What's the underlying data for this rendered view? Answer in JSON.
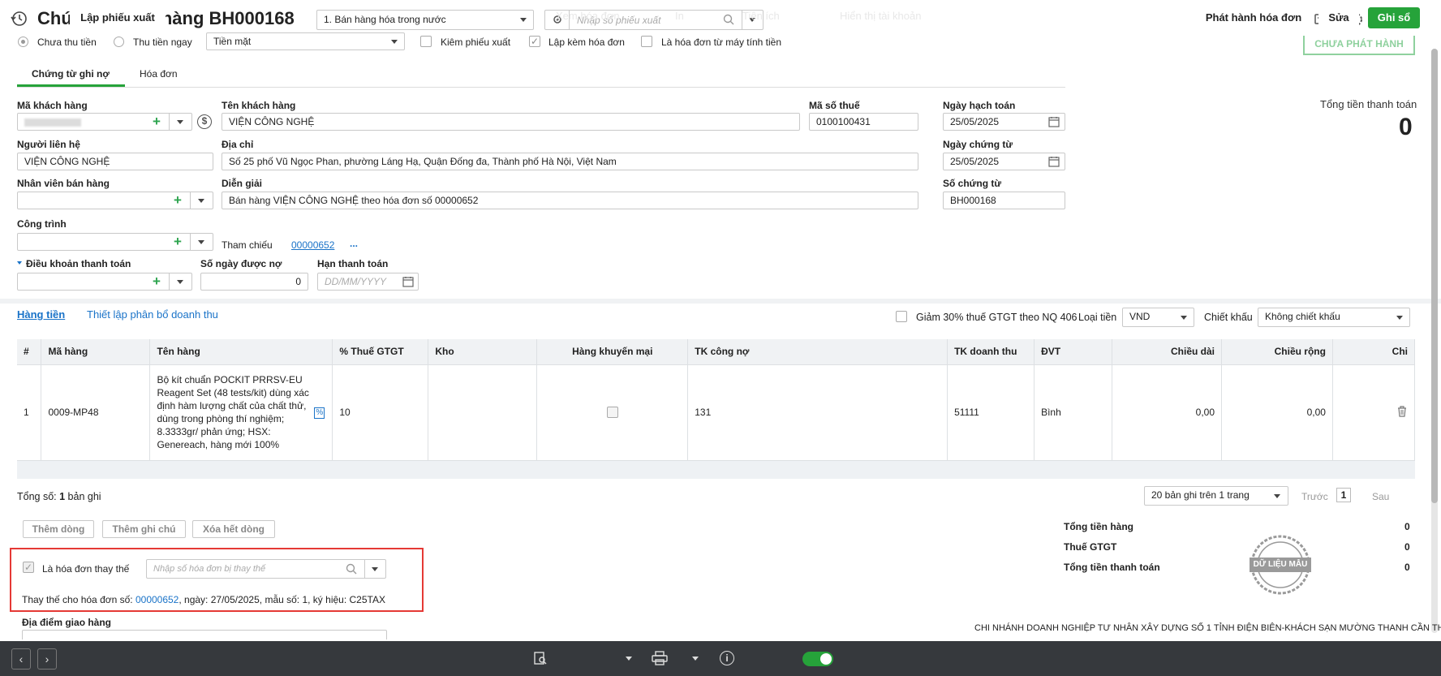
{
  "header": {
    "title": "Chứng từ bán hàng BH000168",
    "type_select": "1. Bán hàng hóa trong nước",
    "export_placeholder": "Nhập số phiếu xuất"
  },
  "payment": {
    "unpaid": "Chưa thu tiền",
    "paid_now": "Thu tiền ngay",
    "method": "Tiền mặt",
    "check_export": "Kiêm phiếu xuất",
    "with_invoice": "Lập kèm hóa đơn",
    "cash_register": "Là hóa đơn từ máy tính tiền"
  },
  "status_stamp": "CHƯA PHÁT HÀNH",
  "tabs": [
    "Chứng từ ghi nợ",
    "Hóa đơn"
  ],
  "form": {
    "customer_code_label": "Mã khách hàng",
    "customer_name_label": "Tên khách hàng",
    "customer_name": "VIỆN CÔNG NGHỆ",
    "tax_code_label": "Mã số thuế",
    "tax_code": "0100100431",
    "posting_date_label": "Ngày hạch toán",
    "posting_date": "25/05/2025",
    "contact_label": "Người liên hệ",
    "contact": "VIỆN CÔNG NGHỆ",
    "address_label": "Địa chỉ",
    "address": "Số 25 phố Vũ Ngọc Phan, phường Láng Hạ, Quận Đống đa, Thành phố Hà Nội, Việt Nam",
    "voucher_date_label": "Ngày chứng từ",
    "voucher_date": "25/05/2025",
    "salesperson_label": "Nhân viên bán hàng",
    "description_label": "Diễn giải",
    "description": "Bán hàng VIỆN CÔNG NGHỆ theo hóa đơn số 00000652",
    "voucher_no_label": "Số chứng từ",
    "voucher_no": "BH000168",
    "project_label": "Công trình",
    "reference_label": "Tham chiếu",
    "reference": "00000652",
    "reference_more": "...",
    "payment_terms_label": "Điều khoản thanh toán",
    "credit_days_label": "Số ngày được nợ",
    "credit_days": "0",
    "due_date_label": "Hạn thanh toán",
    "due_date_placeholder": "DD/MM/YYYY"
  },
  "total_panel": {
    "label": "Tổng tiền thanh toán",
    "value": "0"
  },
  "lines_toolbar": {
    "tab_goods": "Hàng tiền",
    "revenue_allocation": "Thiết lập phân bổ doanh thu",
    "vat_reduction": "Giảm 30% thuế GTGT theo NQ 406",
    "currency_label": "Loại tiền",
    "currency": "VND",
    "discount_label": "Chiết khấu",
    "discount": "Không chiết khấu"
  },
  "table": {
    "headers": [
      "#",
      "Mã hàng",
      "Tên hàng",
      "% Thuế GTGT",
      "Kho",
      "Hàng khuyến mại",
      "TK công nợ",
      "TK doanh thu",
      "ĐVT",
      "Chiều dài",
      "Chiều rộng",
      "Chi"
    ],
    "rows": [
      {
        "no": "1",
        "code": "0009-MP48",
        "name": "Bộ kít chuẩn  POCKIT PRRSV-EU Reagent Set (48 tests/kit) dùng xác định hàm lượng chất của chất thử, dùng trong phòng thí nghiệm; 8.3333gr/ phản ứng; HSX: Genereach, hàng mới 100%",
        "vat": "10",
        "warehouse": "",
        "ar_account": "131",
        "revenue_account": "51111",
        "unit": "Bình",
        "length": "0,00",
        "width": "0,00"
      }
    ]
  },
  "pagination": {
    "total_prefix": "Tổng số: ",
    "total_count": "1",
    "total_suffix": " bản ghi",
    "page_size": "20 bản ghi trên 1 trang",
    "prev": "Trước",
    "page": "1",
    "next": "Sau"
  },
  "line_buttons": {
    "add": "Thêm dòng",
    "add_note": "Thêm ghi chú",
    "delete_all": "Xóa hết dòng"
  },
  "replacement": {
    "label": "Là hóa đơn thay thế",
    "placeholder": "Nhập số hóa đơn bị thay thế",
    "info_prefix": "Thay thế cho hóa đơn số: ",
    "invoice_no": "00000652",
    "info_suffix": ", ngày:  27/05/2025, mẫu số:  1, ký hiệu:  C25TAX"
  },
  "delivery_label": "Địa điểm giao hàng",
  "totals": [
    {
      "label": "Tổng tiền hàng",
      "value": "0"
    },
    {
      "label": "Thuế GTGT",
      "value": "0"
    },
    {
      "label": "Tổng tiền thanh toán",
      "value": "0"
    }
  ],
  "sample_stamp": "DỮ LIỆU MẪU",
  "company_name": "CHI NHÁNH DOANH NGHIỆP TƯ NHÂN XÂY DỰNG SỐ 1 TỈNH ĐIỆN BIÊN-KHÁCH SẠN MƯỜNG THANH CẦN THƠ",
  "bottom_bar": {
    "create_export": "Lập phiếu xuất",
    "view_invoice": "Xem hóa đơn",
    "print": "In",
    "utilities": "Tiện ích",
    "show_account": "Hiển thị tài khoản",
    "issue_invoice": "Phát hành hóa đơn",
    "edit": "Sửa",
    "save": "Ghi sổ"
  },
  "colors": {
    "accent_green": "#26a33a",
    "link_blue": "#1a73c8",
    "highlight_red": "#e53935",
    "bottom_bar": "#36393d"
  }
}
